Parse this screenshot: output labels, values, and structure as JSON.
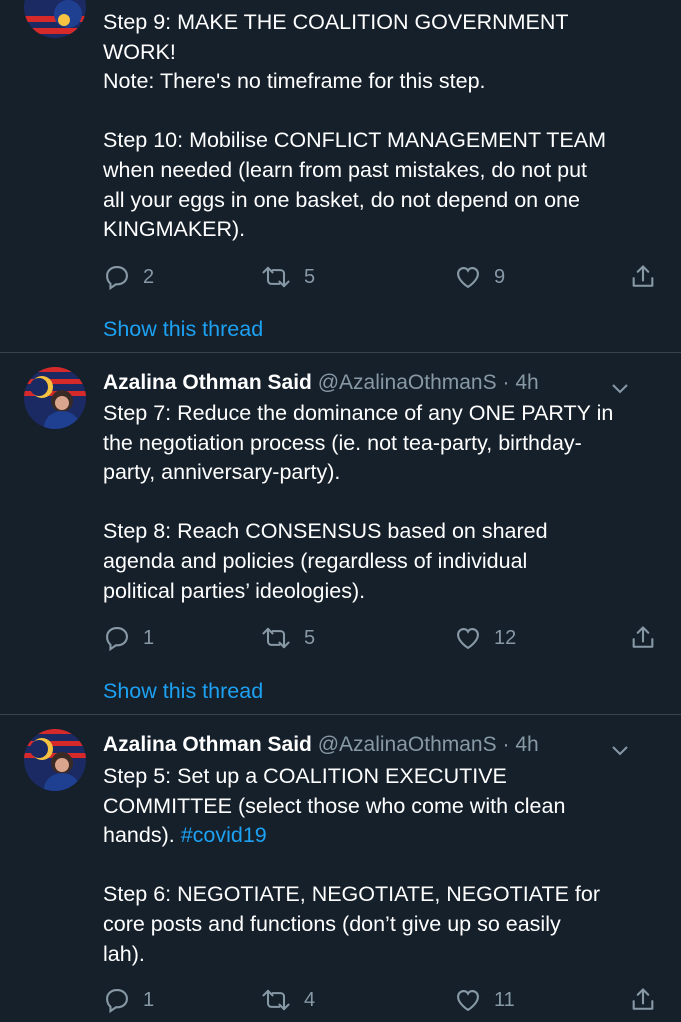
{
  "tweets": [
    {
      "name": "",
      "handle": "",
      "time": "",
      "lines": [
        "Step 9: MAKE THE COALITION GOVERNMENT",
        "WORK!",
        "Note: There's no timeframe for this step.",
        "",
        "Step 10: Mobilise CONFLICT MANAGEMENT TEAM",
        "when needed (learn from past mistakes, do not put",
        "all your eggs in one basket, do not depend on one",
        "KINGMAKER)."
      ],
      "replies": "2",
      "retweets": "5",
      "likes": "9",
      "thread_link": "Show this thread"
    },
    {
      "name": "Azalina Othman Said",
      "handle": "@AzalinaOthmanS",
      "dot": "·",
      "time": "4h",
      "lines": [
        "Step 7: Reduce the dominance of any ONE PARTY in",
        "the negotiation process (ie. not tea-party, birthday-",
        "party, anniversary-party).",
        "",
        "Step 8: Reach CONSENSUS based on shared",
        "agenda and policies (regardless of individual",
        "political parties’ ideologies)."
      ],
      "replies": "1",
      "retweets": "5",
      "likes": "12",
      "thread_link": "Show this thread"
    },
    {
      "name": "Azalina Othman Said",
      "handle": "@AzalinaOthmanS",
      "dot": "·",
      "time": "4h",
      "line1": "Step 5: Set up a COALITION EXECUTIVE",
      "line2": "COMMITTEE (select those who come with clean",
      "line3_text": "hands). ",
      "hashtag": "#covid19",
      "line5": "Step 6: NEGOTIATE, NEGOTIATE, NEGOTIATE for",
      "line6": "core posts and functions (don’t give up so easily",
      "line7": "lah).",
      "replies": "1",
      "retweets": "4",
      "likes": "11"
    }
  ],
  "icons": {
    "reply": "reply-icon",
    "retweet": "retweet-icon",
    "like": "like-icon",
    "share": "share-icon",
    "more": "chevron-down-icon"
  },
  "colors": {
    "background": "#15202b",
    "divider": "#38444d",
    "muted": "#8899a6",
    "link": "#1da1f2"
  }
}
